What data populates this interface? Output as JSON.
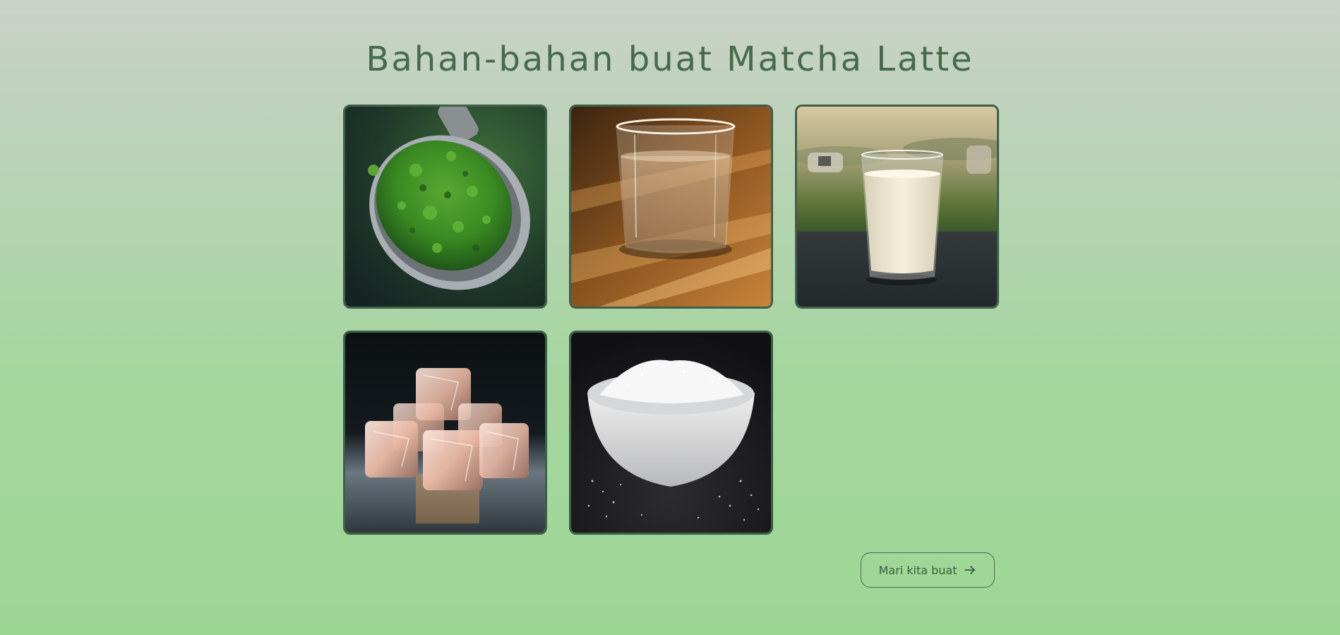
{
  "page": {
    "title": "Bahan-bahan buat Matcha Latte"
  },
  "ingredients": [
    {
      "id": "matcha",
      "icon": "matcha-powder-spoon-image"
    },
    {
      "id": "water",
      "icon": "glass-of-water-image"
    },
    {
      "id": "milk",
      "icon": "glass-of-milk-image"
    },
    {
      "id": "ice",
      "icon": "ice-cubes-image"
    },
    {
      "id": "sugar",
      "icon": "sugar-bowl-image"
    }
  ],
  "actions": {
    "next_label": "Mari kita buat",
    "next_icon": "arrow-right-icon"
  },
  "colors": {
    "title": "#466a4c",
    "card_border": "#3f5f49",
    "button_border": "#4c6a53",
    "background_top": "#cbd1c9",
    "background_bottom": "#9dd794"
  }
}
